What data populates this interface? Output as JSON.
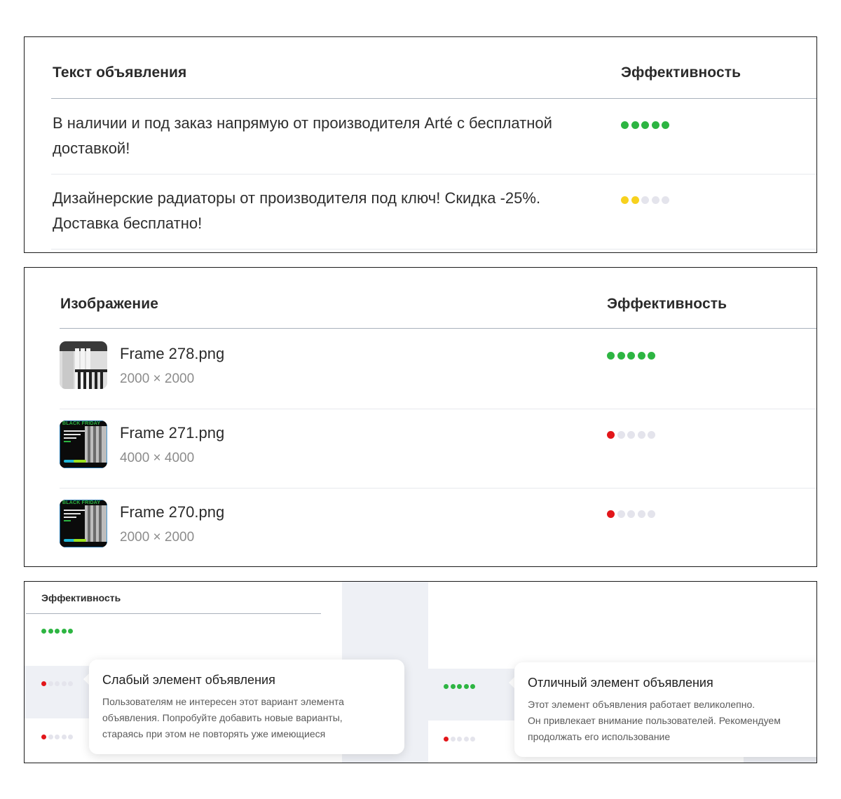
{
  "text_panel": {
    "col_text": "Текст объявления",
    "col_eff": "Эффективность",
    "rows": [
      {
        "line1": "В наличии и под заказ напрямую от производителя Arté с бесплатной",
        "line2": "доставкой!",
        "score": 5,
        "level": "green"
      },
      {
        "line1": "Дизайнерские радиаторы от производителя под ключ! Скидка -25%.",
        "line2": "Доставка бесплатно!",
        "score": 2,
        "level": "yellow"
      }
    ]
  },
  "image_panel": {
    "col_image": "Изображение",
    "col_eff": "Эффективность",
    "rows": [
      {
        "name": "Frame 278.png",
        "size": "2000 × 2000",
        "score": 5,
        "level": "green",
        "thumb_icon": "radiator-photo-thumbnail"
      },
      {
        "name": "Frame 271.png",
        "size": "4000 × 4000",
        "score": 1,
        "level": "red",
        "thumb_icon": "black-friday-banner-thumbnail",
        "thumb_text": "BLACK FRIDAY"
      },
      {
        "name": "Frame 270.png",
        "size": "2000 × 2000",
        "score": 1,
        "level": "red",
        "thumb_icon": "black-friday-banner-thumbnail",
        "thumb_text": "BLACK FRIDAY"
      }
    ]
  },
  "tooltip_panel": {
    "col_eff": "Эффективность",
    "weak": {
      "title": "Слабый элемент объявления",
      "line1": "Пользователям не интересен этот вариант элемента",
      "line2": "объявления. Попробуйте добавить новые варианты,",
      "line3": "стараясь при этом не повторять уже имеющиеся"
    },
    "great": {
      "title": "Отличный элемент объявления",
      "line1": "Этот элемент объявления работает великолепно.",
      "line2": "Он привлекает внимание пользователей. Рекомендуем",
      "line3": "продолжать его использование"
    }
  },
  "colors": {
    "green": "#2db542",
    "yellow": "#f7d11e",
    "red": "#e2161a",
    "empty_dot": "#e4e4ec",
    "row_highlight": "#eef0f5"
  }
}
